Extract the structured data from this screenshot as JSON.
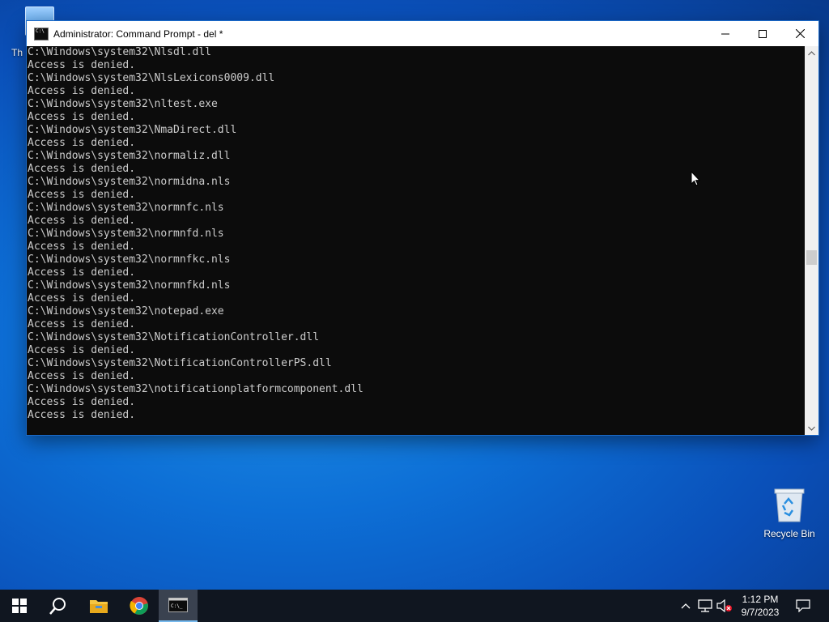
{
  "desktop": {
    "this_pc_label": "Th",
    "recycle_bin_label": "Recycle Bin"
  },
  "window": {
    "title": "Administrator: Command Prompt - del  *",
    "console_lines": [
      "C:\\Windows\\system32\\Nlsdl.dll",
      "Access is denied.",
      "C:\\Windows\\system32\\NlsLexicons0009.dll",
      "Access is denied.",
      "C:\\Windows\\system32\\nltest.exe",
      "Access is denied.",
      "C:\\Windows\\system32\\NmaDirect.dll",
      "Access is denied.",
      "C:\\Windows\\system32\\normaliz.dll",
      "Access is denied.",
      "C:\\Windows\\system32\\normidna.nls",
      "Access is denied.",
      "C:\\Windows\\system32\\normnfc.nls",
      "Access is denied.",
      "C:\\Windows\\system32\\normnfd.nls",
      "Access is denied.",
      "C:\\Windows\\system32\\normnfkc.nls",
      "Access is denied.",
      "C:\\Windows\\system32\\normnfkd.nls",
      "Access is denied.",
      "C:\\Windows\\system32\\notepad.exe",
      "Access is denied.",
      "C:\\Windows\\system32\\NotificationController.dll",
      "Access is denied.",
      "C:\\Windows\\system32\\NotificationControllerPS.dll",
      "Access is denied.",
      "C:\\Windows\\system32\\notificationplatformcomponent.dll",
      "Access is denied.",
      "Access is denied."
    ],
    "scroll_position_fraction": 0.55
  },
  "taskbar": {
    "icons": [
      "windows-start-icon",
      "search-icon",
      "file-explorer-icon",
      "chrome-icon",
      "command-prompt-icon"
    ],
    "clock_time": "1:12 PM",
    "clock_date": "9/7/2023"
  },
  "colors": {
    "console_bg": "#0c0c0c",
    "console_text": "#cccccc",
    "taskbar_bg": "#101620",
    "active_accent": "#76b9ed"
  }
}
